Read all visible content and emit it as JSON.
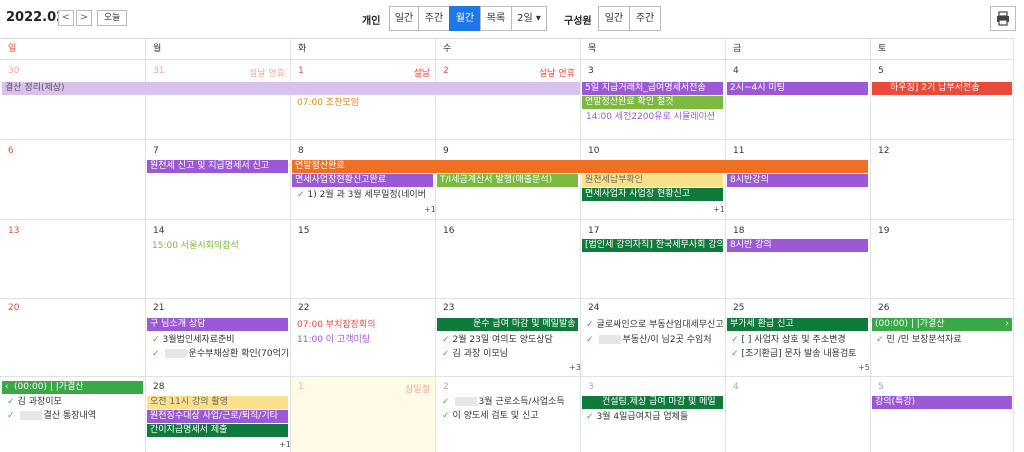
{
  "toolbar": {
    "month": "2022.02",
    "prev": "<",
    "next": ">",
    "today": "오늘",
    "personal_label": "개인",
    "personal_views": [
      "일간",
      "주간",
      "월간",
      "목록",
      "2일 ▾"
    ],
    "members_label": "구성원",
    "member_views": [
      "일간",
      "주간"
    ],
    "print_icon": "printer-icon"
  },
  "weekdays": [
    "일",
    "월",
    "화",
    "수",
    "목",
    "금",
    "토"
  ],
  "weeks": [
    {
      "days": [
        "30",
        "31",
        "1",
        "2",
        "3",
        "4",
        "5"
      ]
    },
    {
      "days": [
        "6",
        "7",
        "8",
        "9",
        "10",
        "11",
        "12"
      ]
    },
    {
      "days": [
        "13",
        "14",
        "15",
        "16",
        "17",
        "18",
        "19"
      ]
    },
    {
      "days": [
        "20",
        "21",
        "22",
        "23",
        "24",
        "25",
        "26"
      ]
    },
    {
      "days": [
        "27",
        "28",
        "1",
        "2",
        "3",
        "4",
        "5"
      ]
    }
  ],
  "holidays": {
    "w0_mon": "설날 연휴",
    "w0_tue": "설날",
    "w0_wed": "설날 연휴",
    "w4_tue": "삼일절"
  },
  "events": {
    "w0_settle": "결산 정리(제상)",
    "w0_thu1": "5일 지급거래처_급여명세서전송",
    "w0_thu2": "연말정산완료 확인 철것",
    "w0_thu3": "14:00 세전2200유로 시뮬레이션",
    "w0_fri1": "2시~4시 미팅",
    "w0_sat1": "하우징] 2기 납부서전송",
    "w0_tue1": "07:00 조찬모임",
    "w1_yearend": "연말정산완료",
    "w1_mon1": "원천세 신고 및 지급명세서 신고",
    "w1_tue1": "면세사업장현황신고완료",
    "w1_tue2": "1) 2월 과 3월 세무일정(네이버",
    "w1_wed1": "T/I세금계산서 발행(매출분석)",
    "w1_thu1": "원천세납부확인",
    "w1_thu2": "면세사업자 사업장 현황신고",
    "w1_fri1": "8시반강의",
    "w1_more_tue": "+1",
    "w1_more_thu": "+1",
    "w2_mon1": "15:00 서울시회의참석",
    "w2_thu1": "[법인세 강의자직] 한국세무사회 강의",
    "w2_fri1": "8시반 강의",
    "w3_mon1": "구      님소개 상담",
    "w3_mon2": "3월법인세자료준비",
    "w3_mon3": "운수부채상환 확인(70억기준",
    "w3_tue1": "07:00 부치잡장회의",
    "w3_tue2": "11:00 이      고객미팅",
    "w3_wed1": "운수 급여 마감 및 메일발송",
    "w3_wed2": "2월 23일 여의도 양도상담",
    "w3_wed3": "김      과장 이모님",
    "w3_thu1": "글로싸인으로 부동산임대세무신고",
    "w3_thu2": "부동산/이      님2곳 수임처",
    "w3_fri1": "부가세 환급 신고",
    "w3_fri2": "[      ] 사업자 상호 및 주소변경",
    "w3_fri3": "[조기환급] 문자 발송 내용검토",
    "w3_sat1": "(00:00) |            |가결산",
    "w3_sat2": "민       /민        보장분석자료",
    "w3_more_wed": "+3",
    "w3_more_fri": "+5",
    "w4_sun1": "(00:00) |            |가결산",
    "w4_sun2": "김      과장이모",
    "w4_sun3": "결산 통장내역",
    "w4_mon1": "오전 11시 강의 촬영",
    "w4_mon2": "원천징수대상 사업/근로/퇴직/기타",
    "w4_mon3": "간이지급명세서 제출",
    "w4_wed1": "3월 근로소득/사업소득",
    "w4_wed2": "이      양도세 검토 및 신고",
    "w4_thu1": "건설팀,제상 급여 마감 및 메일",
    "w4_thu2": "3월 4일급여지급 업체들",
    "w4_sat1": "강의(특강)",
    "w4_more_mon": "+1"
  },
  "colors": {
    "purple": "#9b59d6",
    "lavender": "#d9c3ec",
    "green": "#7cb93f",
    "darkgreen": "#0f7a3b",
    "orange": "#ef7022",
    "yellow": "#f9e08a",
    "red": "#e84b3c",
    "blue": "#1d77e6"
  }
}
